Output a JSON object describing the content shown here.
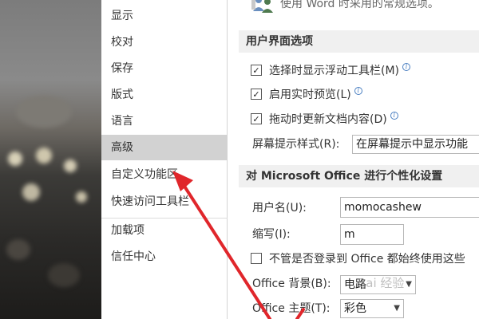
{
  "nav": {
    "items": [
      {
        "label": "显示"
      },
      {
        "label": "校对"
      },
      {
        "label": "保存"
      },
      {
        "label": "版式"
      },
      {
        "label": "语言"
      },
      {
        "label": "高级"
      },
      {
        "label": "自定义功能区"
      },
      {
        "label": "快速访问工具栏"
      },
      {
        "label": "加载项"
      },
      {
        "label": "信任中心"
      }
    ],
    "selected_index": 5
  },
  "intro": {
    "text": "使用 Word 时采用的常规选项。"
  },
  "ui_options": {
    "header": "用户界面选项",
    "checkboxes": [
      {
        "label": "选择时显示浮动工具栏(M)",
        "checked": true
      },
      {
        "label": "启用实时预览(L)",
        "checked": true
      },
      {
        "label": "拖动时更新文档内容(D)",
        "checked": true
      }
    ],
    "screentip_label": "屏幕提示样式(R):",
    "screentip_value": "在屏幕提示中显示功能"
  },
  "personalize": {
    "header": "对 Microsoft Office 进行个性化设置",
    "username_label": "用户名(U):",
    "username_value": "momocashew",
    "initials_label": "缩写(I):",
    "initials_value": "m",
    "always_use_label": "不管是否登录到 Office 都始终使用这些",
    "always_use_checked": false,
    "background_label": "Office 背景(B):",
    "background_value": "电路",
    "theme_label": "Office 主题(T):",
    "theme_value": "彩色"
  },
  "watermark": "Bai 经验",
  "colors": {
    "arrow": "#e0262b",
    "selected_nav": "#d2d2d2",
    "section_header_bg": "#f0f0f0"
  }
}
